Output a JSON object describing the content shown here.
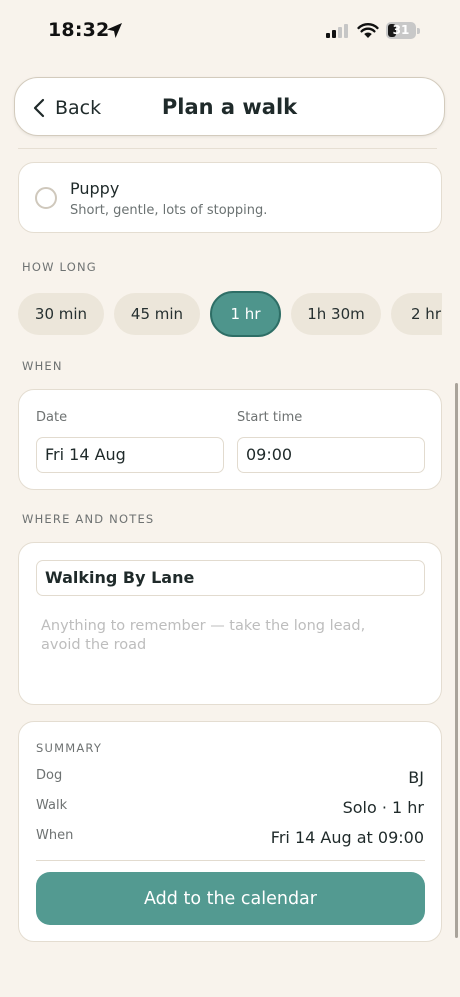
{
  "status_bar": {
    "time": "18:32",
    "battery": "31",
    "battery_level": 0.31
  },
  "header": {
    "back_label": "Back",
    "title": "Plan a walk"
  },
  "option": {
    "title": "Puppy",
    "description": "Short, gentle, lots of stopping.",
    "selected": false
  },
  "how_long": {
    "label": "HOW LONG",
    "chips": [
      "30 min",
      "45 min",
      "1 hr",
      "1h 30m",
      "2 hr"
    ],
    "selected": "1 hr"
  },
  "when": {
    "label": "WHEN",
    "date_label": "Date",
    "date_value": "Fri 14 Aug",
    "time_label": "Start time",
    "time_value": "09:00"
  },
  "notes": {
    "label": "WHERE AND NOTES",
    "location_value": "Walking By Lane",
    "notes_placeholder": "Anything to remember — take the long lead, avoid the road"
  },
  "summary": {
    "label": "SUMMARY",
    "rows": [
      {
        "label": "Dog",
        "value": "BJ"
      },
      {
        "label": "Walk",
        "value": "Solo · 1 hr"
      },
      {
        "label": "When",
        "value": "Fri 14 Aug at 09:00"
      }
    ],
    "cta_label": "Add to the calendar"
  },
  "colors": {
    "background": "#f8f3ec",
    "accent": "#539a91",
    "accent_dark": "#2e6e66",
    "chip": "#ece6da"
  }
}
